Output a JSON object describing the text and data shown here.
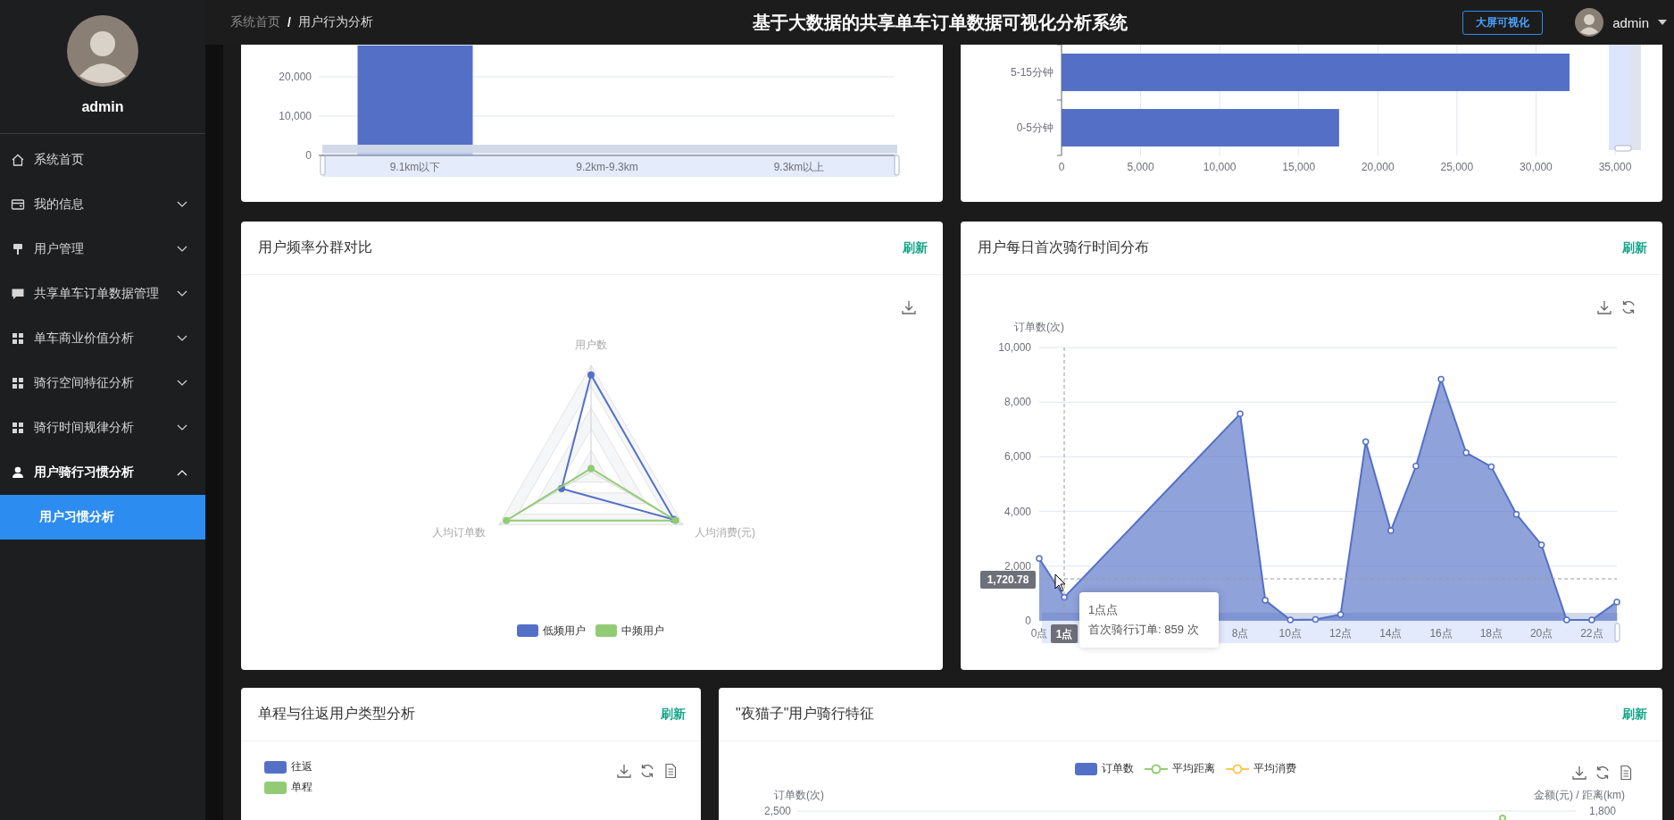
{
  "sidebar": {
    "user_name": "admin",
    "menu": [
      {
        "label": "系统首页",
        "kind": "home"
      },
      {
        "label": "我的信息",
        "kind": "card",
        "expanded": false
      },
      {
        "label": "用户管理",
        "kind": "stamp",
        "expanded": false
      },
      {
        "label": "共享单车订单数据管理",
        "kind": "chat",
        "expanded": false
      },
      {
        "label": "单车商业价值分析",
        "kind": "grid",
        "expanded": false
      },
      {
        "label": "骑行空间特征分析",
        "kind": "grid",
        "expanded": false
      },
      {
        "label": "骑行时间规律分析",
        "kind": "grid",
        "expanded": false
      },
      {
        "label": "用户骑行习惯分析",
        "kind": "user",
        "expanded": true,
        "children": [
          {
            "label": "用户习惯分析",
            "selected": true
          }
        ]
      }
    ]
  },
  "header": {
    "breadcrumb": [
      "系统首页",
      "用户行为分析"
    ],
    "breadcrumb_separator": "/",
    "title": "基于大数据的共享单车订单数据可视化分析系统",
    "bigscreen_button": "大屏可视化",
    "user_name": "admin"
  },
  "distance_chart": {
    "chart_data": {
      "type": "bar",
      "categories": [
        "9.1km以下",
        "9.2km-9.3km",
        "9.3km以上"
      ],
      "values": [
        28000,
        0,
        0
      ],
      "ylim": [
        0,
        28000
      ],
      "grid": true,
      "yticks": [
        {
          "value": 0,
          "label": "0"
        },
        {
          "value": 10000,
          "label": "10,000"
        },
        {
          "value": 20000,
          "label": "20,000"
        }
      ]
    }
  },
  "duration_chart": {
    "chart_data": {
      "type": "bar",
      "orientation": "horizontal",
      "categories": [
        "5-15分钟",
        "0-5分钟"
      ],
      "values": [
        32120,
        17550
      ],
      "xlim": [
        0,
        35000
      ],
      "grid": true,
      "xticks": [
        {
          "value": 0,
          "label": "0"
        },
        {
          "value": 5000,
          "label": "5,000"
        },
        {
          "value": 10000,
          "label": "10,000"
        },
        {
          "value": 15000,
          "label": "15,000"
        },
        {
          "value": 20000,
          "label": "20,000"
        },
        {
          "value": 25000,
          "label": "25,000"
        },
        {
          "value": 30000,
          "label": "30,000"
        },
        {
          "value": 35000,
          "label": "35,000"
        }
      ]
    }
  },
  "frequency_panel": {
    "title": "用户频率分群对比",
    "refresh": "刷新",
    "indicators": [
      "用户数",
      "人均订单数",
      "人均消费(元)"
    ],
    "legend": [
      {
        "name": "低频用户",
        "color": "#5470c6"
      },
      {
        "name": "中频用户",
        "color": "#91cc75"
      }
    ]
  },
  "first_ride_panel": {
    "title": "用户每日首次骑行时间分布",
    "refresh": "刷新",
    "chart_data": {
      "type": "area",
      "ylabel": "订单数(次)",
      "grid": true,
      "x": [
        0,
        1,
        8,
        9,
        10,
        11,
        12,
        13,
        14,
        15,
        16,
        17,
        18,
        19,
        20,
        21,
        22,
        23
      ],
      "series": [
        {
          "color": "#5470c6",
          "values": [
            2280,
            859,
            7570,
            750,
            30,
            50,
            230,
            6550,
            3300,
            5660,
            8840,
            6150,
            5640,
            3900,
            2780,
            30,
            30,
            690
          ]
        }
      ],
      "xlim": [
        0,
        23
      ],
      "ylim": [
        0,
        10000
      ],
      "yticks": [
        {
          "value": 0,
          "label": "0"
        },
        {
          "value": 2000,
          "label": "2,000"
        },
        {
          "value": 4000,
          "label": "4,000"
        },
        {
          "value": 6000,
          "label": "6,000"
        },
        {
          "value": 8000,
          "label": "8,000"
        },
        {
          "value": 10000,
          "label": "10,000"
        }
      ],
      "xticks": [
        {
          "value": 0,
          "label": "0点"
        },
        {
          "value": 8,
          "label": "8点"
        },
        {
          "value": 10,
          "label": "10点"
        },
        {
          "value": 12,
          "label": "12点"
        },
        {
          "value": 14,
          "label": "14点"
        },
        {
          "value": 16,
          "label": "16点"
        },
        {
          "value": 18,
          "label": "18点"
        },
        {
          "value": 20,
          "label": "20点"
        },
        {
          "value": 22,
          "label": "22点"
        }
      ]
    },
    "pointer": {
      "y_label": "1,720.78",
      "x_label": "1点"
    },
    "tooltip": {
      "title": "1点点",
      "text": "首次骑行订单: 859 次"
    }
  },
  "trip_type_panel": {
    "title": "单程与往返用户类型分析",
    "refresh": "刷新",
    "legend": [
      {
        "name": "往返",
        "color": "#5470c6"
      },
      {
        "name": "单程",
        "color": "#91cc75"
      }
    ]
  },
  "night_owl_panel": {
    "title": "\"夜猫子\"用户骑行特征",
    "refresh": "刷新",
    "legend": [
      {
        "name": "订单数",
        "color": "#5470c6",
        "kind": "bar"
      },
      {
        "name": "平均距离",
        "color": "#91cc75",
        "kind": "line"
      },
      {
        "name": "平均消费",
        "color": "#fac858",
        "kind": "line"
      }
    ],
    "left_axis_title": "订单数(次)",
    "left_tick": "2,500",
    "right_axis_title": "金额(元) / 距离(km)",
    "right_tick": "1,800"
  }
}
